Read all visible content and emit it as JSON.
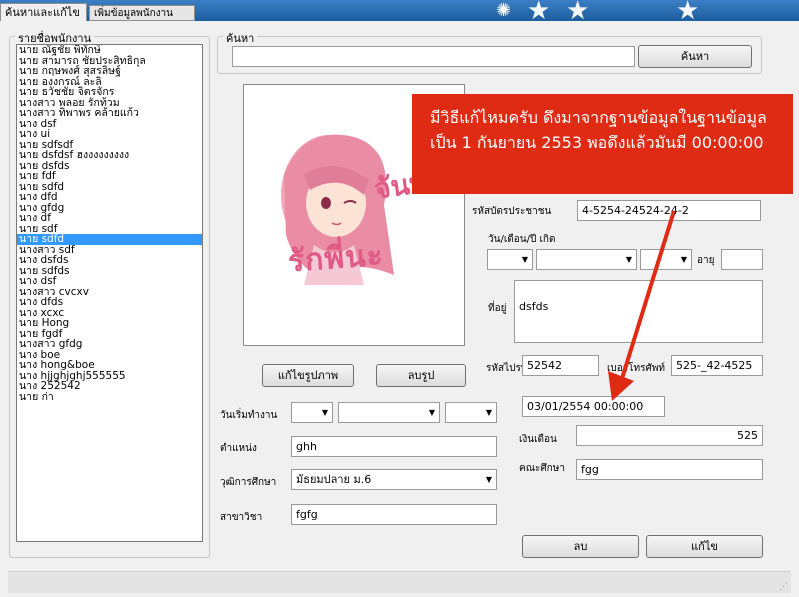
{
  "tabs": {
    "search": "ค้นหาและแก้ไข",
    "add": "เพิ่มข้อมูลพนักงาน"
  },
  "employee_list": {
    "legend": "รายชื่อพนักงาน",
    "items": [
      "นาย ณัฐชัย พิทักษ์",
      "นาย สามารถ ชัยประสิทธิกุล",
      "นาย กฤษพงศ์ สุสรลิษฐ์",
      "นาย องงกรณ์ ละลิ",
      "นาย ธวัชชัย จิตรจักร",
      "นางสาว พลอย รักท้วม",
      "นางสาว ทิพาพร คล้ายแก้ว",
      "นาง dsf",
      "นาง ui",
      "นาย sdfsdf",
      "นาย dsfdsf ฮงงงงงงงงง",
      "นาย dsfds",
      "นาย fdf",
      "นาย sdfd",
      "นาง dfd",
      "นาง gfdg",
      "นาง df",
      "นาย sdf",
      "นาย sdfd",
      "นางสาว sdf",
      "นาง dsfds",
      "นาย sdfds",
      "นาง dsf",
      "นางสาว cvcxv",
      "นาง dfds",
      "นาง xcxc",
      "นาย Hong",
      "นาย fgdf",
      "นางสาว gfdg",
      "นาง boe",
      "นาง hong&boe",
      "นาง hjjghjghj555555",
      "นาง 252542",
      "นาย ก่า"
    ],
    "selected_index": 18
  },
  "search": {
    "legend": "ค้นหา",
    "value": "",
    "button": "ค้นหา"
  },
  "photo": {
    "text_top": "จันทร์",
    "text_bottom": "รักพี่นะ",
    "edit_button": "แก้ไขรูปภาพ",
    "delete_button": "ลบรูป"
  },
  "callout": {
    "line1": "มีวิธีแก้ไหมครับ ดึงมาจากฐานข้อมูลในฐานข้อมูล",
    "line2": "เป็น 1 กันยายน 2553 พอดึงแล้วมันมี 00:00:00"
  },
  "form": {
    "id_card_label": "รหัสบัตรประชาชน",
    "id_card_value": "4-5254-24524-24-2",
    "birthdate_label": "วัน/เดือน/ปี เกิด",
    "age_label": "อายุ",
    "age_value": "",
    "address_label": "ที่อยู่",
    "address_value": "dsfds",
    "postal_label": "รหัสไปรษณีย์",
    "postal_value": "52542",
    "phone_label": "เบอร์โทรศัพท์",
    "phone_value": "525-_42-4525",
    "start_date_label": "วันเริ่มทำงาน",
    "start_date_value": "03/01/2554 00:00:00",
    "position_label": "ตำแหน่ง",
    "position_value": "ghh",
    "salary_label": "เงินเดือน",
    "salary_value": "525",
    "education_label": "วุฒิการศึกษา",
    "education_value": "มัธยมปลาย ม.6",
    "faculty_label": "คณะศึกษา",
    "faculty_value": "fgg",
    "major_label": "สาขาวิชา",
    "major_value": "fgfg"
  },
  "actions": {
    "delete": "ลบ",
    "edit": "แก้ไข"
  },
  "colors": {
    "callout": "#e02b14",
    "selection": "#3399ff",
    "header": "#1c5d9f"
  }
}
